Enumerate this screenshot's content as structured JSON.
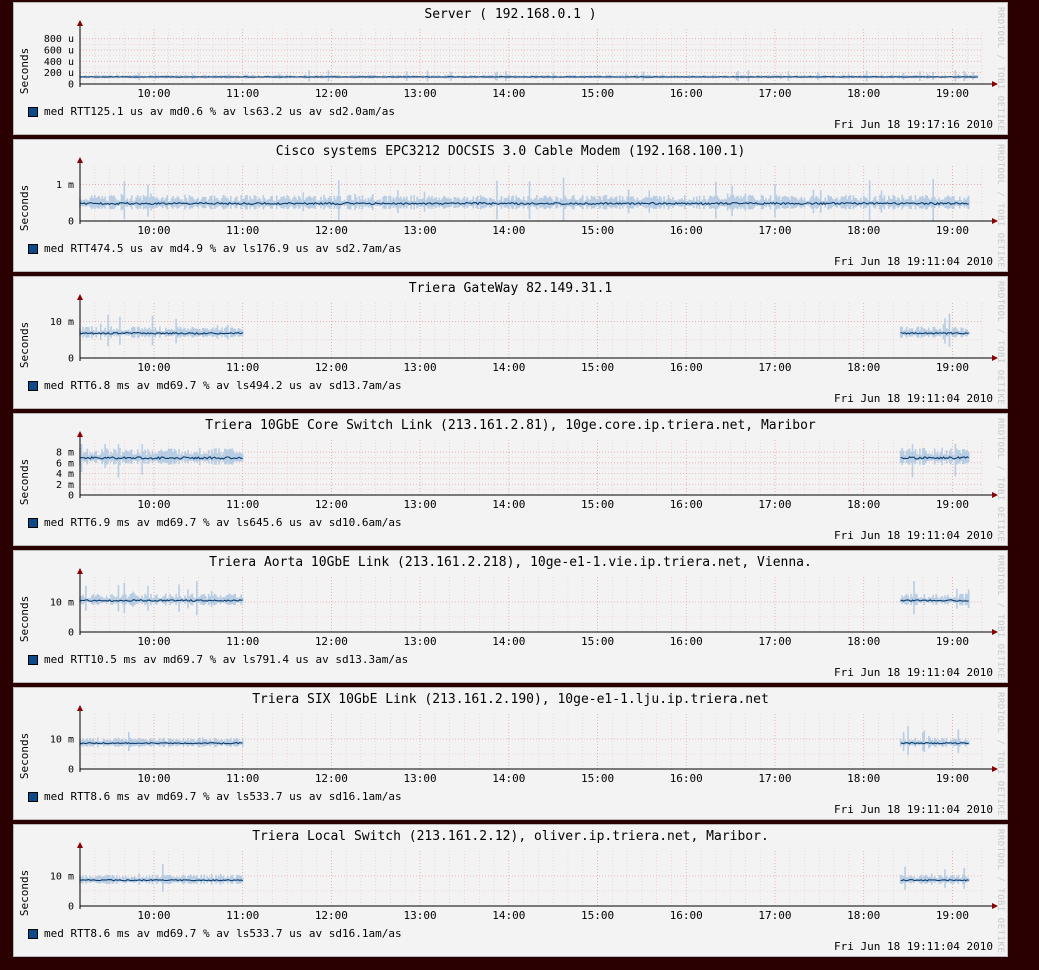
{
  "chart_data": [
    {
      "type": "line",
      "title": "Server ( 192.168.0.1 )",
      "ylabel": "Seconds",
      "ylim": [
        0,
        0.0009
      ],
      "yticks": [
        {
          "v": 0,
          "label": "0"
        },
        {
          "v": 0.0002,
          "label": "200 u"
        },
        {
          "v": 0.0004,
          "label": "400 u"
        },
        {
          "v": 0.0006,
          "label": "600 u"
        },
        {
          "v": 0.0008,
          "label": "800 u"
        }
      ],
      "x_ticks": [
        "10:00",
        "11:00",
        "12:00",
        "13:00",
        "14:00",
        "15:00",
        "16:00",
        "17:00",
        "18:00",
        "19:00"
      ],
      "series": [
        {
          "name": "med RTT",
          "x_start": "09:10",
          "x_end": "19:17",
          "level": 0.000125,
          "spread": 2.5e-05,
          "gap": null
        }
      ],
      "legend": {
        "label": "med RTT",
        "avg": "125.1 us av md",
        "loss": "0.6 % av ls",
        "sd": "63.2 us av sd",
        "amas": "2.0",
        "amas_unit": "am/as"
      },
      "timestamp": "Fri Jun 18 19:17:16 2010"
    },
    {
      "type": "line",
      "title": "Cisco systems EPC3212 DOCSIS 3.0 Cable Modem (192.168.100.1)",
      "ylabel": "Seconds",
      "ylim": [
        0,
        0.0014
      ],
      "yticks": [
        {
          "v": 0,
          "label": "0"
        },
        {
          "v": 0.001,
          "label": "1 m"
        }
      ],
      "x_ticks": [
        "10:00",
        "11:00",
        "12:00",
        "13:00",
        "14:00",
        "15:00",
        "16:00",
        "17:00",
        "18:00",
        "19:00"
      ],
      "series": [
        {
          "name": "med RTT",
          "x_start": "09:10",
          "x_end": "19:11",
          "level": 0.00048,
          "spread": 0.00015,
          "gap": null
        }
      ],
      "legend": {
        "label": "med RTT",
        "avg": "474.5 us av md",
        "loss": "4.9 % av ls",
        "sd": "176.9 us av sd",
        "amas": "2.7",
        "amas_unit": "am/as"
      },
      "timestamp": "Fri Jun 18 19:11:04 2010"
    },
    {
      "type": "line",
      "title": "Triera GateWay 82.149.31.1",
      "ylabel": "Seconds",
      "ylim": [
        0,
        0.014
      ],
      "yticks": [
        {
          "v": 0,
          "label": "0"
        },
        {
          "v": 0.01,
          "label": "10 m"
        }
      ],
      "x_ticks": [
        "10:00",
        "11:00",
        "12:00",
        "13:00",
        "14:00",
        "15:00",
        "16:00",
        "17:00",
        "18:00",
        "19:00"
      ],
      "series": [
        {
          "name": "med RTT",
          "x_start": "09:10",
          "x_end": "19:11",
          "level": 0.0068,
          "spread": 0.0012,
          "gap": [
            "11:00",
            "18:25"
          ]
        }
      ],
      "legend": {
        "label": "med RTT",
        "avg": "6.8 ms av md",
        "loss": "69.7 % av ls",
        "sd": "494.2 us av sd",
        "amas": "13.7",
        "amas_unit": "am/as"
      },
      "timestamp": "Fri Jun 18 19:11:04 2010"
    },
    {
      "type": "line",
      "title": "Triera 10GbE Core Switch Link (213.161.2.81), 10ge.core.ip.triera.net, Maribor",
      "ylabel": "Seconds",
      "ylim": [
        0,
        0.0095
      ],
      "yticks": [
        {
          "v": 0,
          "label": "0"
        },
        {
          "v": 0.002,
          "label": "2 m"
        },
        {
          "v": 0.004,
          "label": "4 m"
        },
        {
          "v": 0.006,
          "label": "6 m"
        },
        {
          "v": 0.008,
          "label": "8 m"
        }
      ],
      "x_ticks": [
        "10:00",
        "11:00",
        "12:00",
        "13:00",
        "14:00",
        "15:00",
        "16:00",
        "17:00",
        "18:00",
        "19:00"
      ],
      "series": [
        {
          "name": "med RTT",
          "x_start": "09:10",
          "x_end": "19:11",
          "level": 0.0069,
          "spread": 0.0012,
          "gap": [
            "11:00",
            "18:25"
          ]
        }
      ],
      "legend": {
        "label": "med RTT",
        "avg": "6.9 ms av md",
        "loss": "69.7 % av ls",
        "sd": "645.6 us av sd",
        "amas": "10.6",
        "amas_unit": "am/as"
      },
      "timestamp": "Fri Jun 18 19:11:04 2010"
    },
    {
      "type": "line",
      "title": "Triera Aorta 10GbE Link (213.161.2.218), 10ge-e1-1.vie.ip.triera.net, Vienna.",
      "ylabel": "Seconds",
      "ylim": [
        0,
        0.017
      ],
      "yticks": [
        {
          "v": 0,
          "label": "0"
        },
        {
          "v": 0.01,
          "label": "10 m"
        }
      ],
      "x_ticks": [
        "10:00",
        "11:00",
        "12:00",
        "13:00",
        "14:00",
        "15:00",
        "16:00",
        "17:00",
        "18:00",
        "19:00"
      ],
      "series": [
        {
          "name": "med RTT",
          "x_start": "09:10",
          "x_end": "19:11",
          "level": 0.0105,
          "spread": 0.0015,
          "gap": [
            "11:00",
            "18:25"
          ]
        }
      ],
      "legend": {
        "label": "med RTT",
        "avg": "10.5 ms av md",
        "loss": "69.7 % av ls",
        "sd": "791.4 us av sd",
        "amas": "13.3",
        "amas_unit": "am/as"
      },
      "timestamp": "Fri Jun 18 19:11:04 2010"
    },
    {
      "type": "line",
      "title": "Triera SIX 10GbE Link (213.161.2.190), 10ge-e1-1.lju.ip.triera.net",
      "ylabel": "Seconds",
      "ylim": [
        0,
        0.017
      ],
      "yticks": [
        {
          "v": 0,
          "label": "0"
        },
        {
          "v": 0.01,
          "label": "10 m"
        }
      ],
      "x_ticks": [
        "10:00",
        "11:00",
        "12:00",
        "13:00",
        "14:00",
        "15:00",
        "16:00",
        "17:00",
        "18:00",
        "19:00"
      ],
      "series": [
        {
          "name": "med RTT",
          "x_start": "09:10",
          "x_end": "19:11",
          "level": 0.0086,
          "spread": 0.0012,
          "gap": [
            "11:00",
            "18:25"
          ]
        }
      ],
      "legend": {
        "label": "med RTT",
        "avg": "8.6 ms av md",
        "loss": "69.7 % av ls",
        "sd": "533.7 us av sd",
        "amas": "16.1",
        "amas_unit": "am/as"
      },
      "timestamp": "Fri Jun 18 19:11:04 2010"
    },
    {
      "type": "line",
      "title": "Triera Local Switch (213.161.2.12), oliver.ip.triera.net, Maribor.",
      "ylabel": "Seconds",
      "ylim": [
        0,
        0.017
      ],
      "yticks": [
        {
          "v": 0,
          "label": "0"
        },
        {
          "v": 0.01,
          "label": "10 m"
        }
      ],
      "x_ticks": [
        "10:00",
        "11:00",
        "12:00",
        "13:00",
        "14:00",
        "15:00",
        "16:00",
        "17:00",
        "18:00",
        "19:00"
      ],
      "series": [
        {
          "name": "med RTT",
          "x_start": "09:10",
          "x_end": "19:11",
          "level": 0.0086,
          "spread": 0.0012,
          "gap": [
            "11:00",
            "18:25"
          ]
        }
      ],
      "legend": {
        "label": "med RTT",
        "avg": "8.6 ms av md",
        "loss": "69.7 % av ls",
        "sd": "533.7 us av sd",
        "amas": "16.1",
        "amas_unit": "am/as"
      },
      "timestamp": "Fri Jun 18 19:11:04 2010"
    }
  ],
  "watermark": "RRDTOOL / TOBI OETIKER",
  "colors": {
    "median": "#0b3d6e",
    "smoke": "#b8cde3",
    "grid": "#e5a8a8",
    "axis": "#880000",
    "background": "#f3f3f3",
    "page": "#2a0000"
  }
}
